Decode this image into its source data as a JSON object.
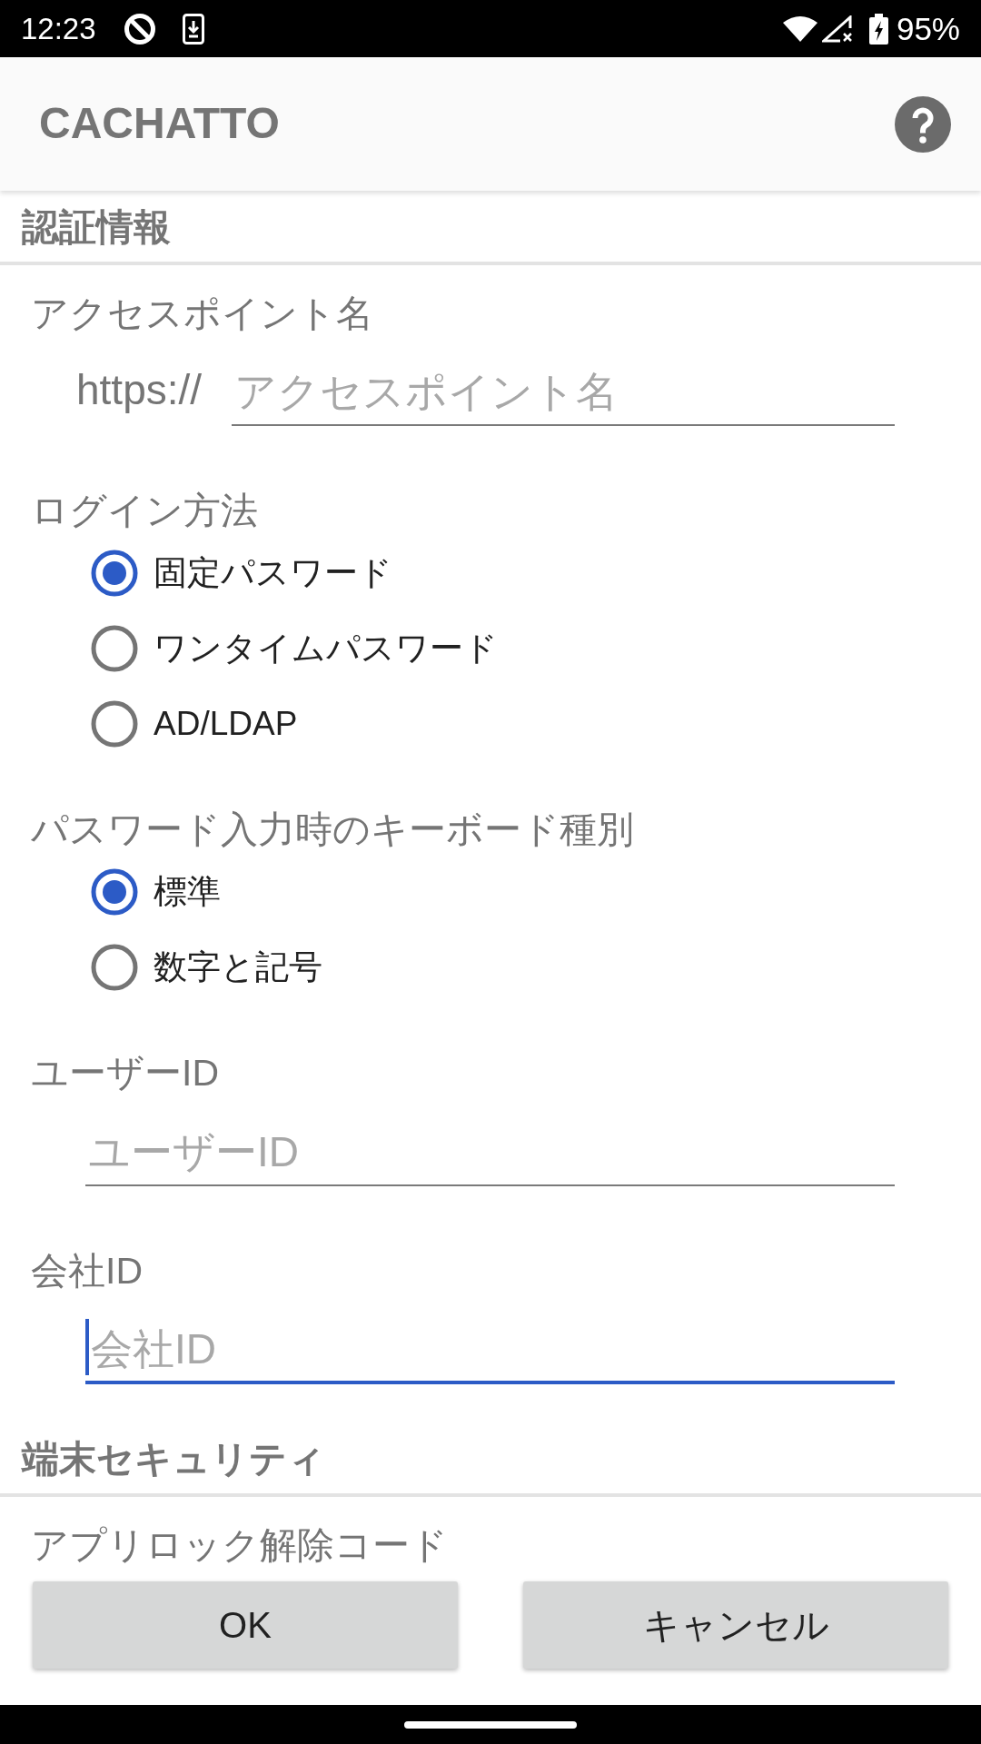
{
  "status_bar": {
    "time": "12:23",
    "battery": "95%"
  },
  "app_bar": {
    "title": "CACHATTO"
  },
  "sections": [
    {
      "title": "認証情報",
      "fields": [
        {
          "kind": "url_input",
          "label": "アクセスポイント名",
          "prefix": "https://",
          "placeholder": "アクセスポイント名",
          "focused": false
        },
        {
          "kind": "radio_group",
          "label": "ログイン方法",
          "options": [
            {
              "label": "固定パスワード",
              "selected": true
            },
            {
              "label": "ワンタイムパスワード",
              "selected": false
            },
            {
              "label": "AD/LDAP",
              "selected": false
            }
          ]
        },
        {
          "kind": "radio_group",
          "label": "パスワード入力時のキーボード種別",
          "options": [
            {
              "label": "標準",
              "selected": true
            },
            {
              "label": "数字と記号",
              "selected": false
            }
          ]
        },
        {
          "kind": "text_input",
          "label": "ユーザーID",
          "placeholder": "ユーザーID",
          "focused": false
        },
        {
          "kind": "text_input",
          "label": "会社ID",
          "placeholder": "会社ID",
          "focused": true
        }
      ]
    },
    {
      "title": "端末セキュリティ",
      "fields": [
        {
          "kind": "label",
          "label": "アプリロック解除コード"
        }
      ]
    }
  ],
  "buttons": [
    "OK",
    "キャンセル"
  ]
}
